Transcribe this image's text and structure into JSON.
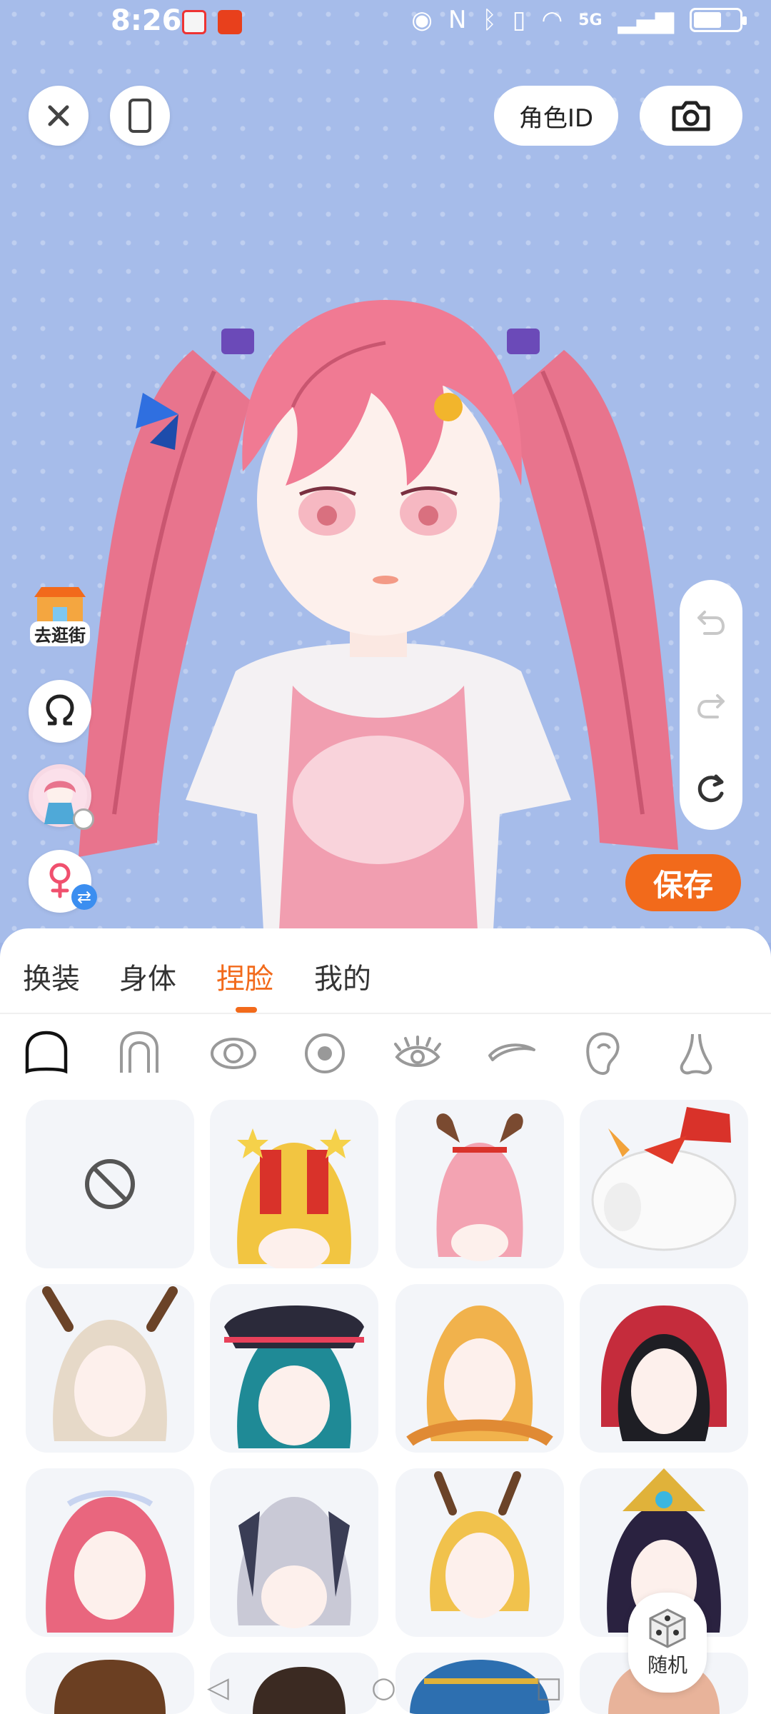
{
  "status": {
    "time": "8:26",
    "signal_label": "5G"
  },
  "top": {
    "role_id_label": "角色ID"
  },
  "side": {
    "street_label": "去逛街"
  },
  "save_label": "保存",
  "tabs": [
    {
      "label": "换装",
      "active": false
    },
    {
      "label": "身体",
      "active": false
    },
    {
      "label": "捏脸",
      "active": true
    },
    {
      "label": "我的",
      "active": false
    }
  ],
  "part_icons": [
    "head-shape-icon",
    "hair-shape-icon",
    "eye-shape-icon",
    "eyeball-icon",
    "eyelash-icon",
    "eyebrow-icon",
    "ear-icon",
    "nose-icon"
  ],
  "random_label": "随机",
  "colors": {
    "accent": "#f26a1b",
    "scene_bg": "#a6bcea",
    "card_bg": "#f3f5f9"
  }
}
